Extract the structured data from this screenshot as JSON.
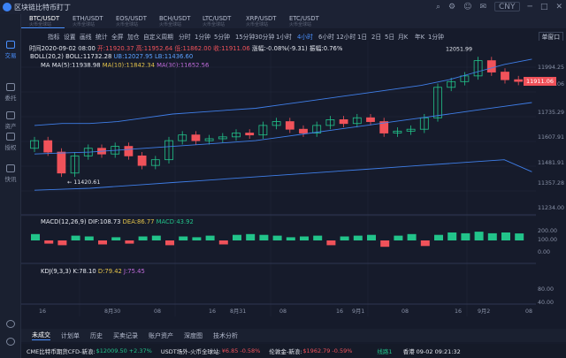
{
  "titlebar": {
    "title": "区块链比特币盯丁",
    "currency": "CNY"
  },
  "sidebar": {
    "items": [
      {
        "label": "交易"
      },
      {
        "label": "委托"
      },
      {
        "label": "资产"
      },
      {
        "label": "授权"
      },
      {
        "label": "快讯"
      }
    ]
  },
  "tabs": [
    {
      "label": "BTC/USDT",
      "sub": "火币全球站"
    },
    {
      "label": "ETH/USDT",
      "sub": "火币全球站"
    },
    {
      "label": "EOS/USDT",
      "sub": "火币全球站"
    },
    {
      "label": "BCH/USDT",
      "sub": "火币全球站"
    },
    {
      "label": "LTC/USDT",
      "sub": "火币全球站"
    },
    {
      "label": "XRP/USDT",
      "sub": "火币全球站"
    },
    {
      "label": "ETC/USDT",
      "sub": "火币全球站"
    }
  ],
  "toolbar": {
    "buttons": [
      "指标",
      "设置",
      "画线",
      "统计",
      "全屏",
      "加仓",
      "自定义周期",
      "分时",
      "1分钟",
      "5分钟",
      "15分钟",
      "30分钟",
      "1小时",
      "4小时",
      "6小时",
      "12小时",
      "1日",
      "2日",
      "5日",
      "月K",
      "年K",
      "1分钟"
    ],
    "active": "4小时",
    "layout": "单窗口"
  },
  "info": {
    "time": "时间2020-09-02 08:00",
    "open": "开:11920.37",
    "high": "高:11952.64",
    "low": "低:11862.00",
    "close": "收:11911.06",
    "change": "涨幅:-0.08%(-9.31)",
    "amp": "振幅:0.76%"
  },
  "legends": {
    "boll": {
      "name": "BOLL(20,2)",
      "boll": "BOLL:11732.28",
      "ub": "UB:12027.95",
      "lb": "LB:11436.60"
    },
    "ma": {
      "name": "MA",
      "ma5": "MA(5):11938.98",
      "ma10": "MA(10):11842.34",
      "ma30": "MA(30):11652.56"
    },
    "macd": {
      "name": "MACD(12,26,9)",
      "dif": "DIF:108.73",
      "dea": "DEA:86.77",
      "macd": "MACD:43.92"
    },
    "kdj": {
      "name": "KDJ(9,3,3)",
      "k": "K:78.10",
      "d": "D:79.42",
      "j": "J:75.45"
    }
  },
  "axis": {
    "price": [
      "11994.25",
      "11864.06",
      "11735.29",
      "11607.91",
      "11481.91",
      "11357.28",
      "11234.00"
    ],
    "macd": [
      "200.00",
      "100.00",
      "0.00"
    ],
    "kdj": [
      "80.00",
      "40.00"
    ],
    "current": "11911.06"
  },
  "annotations": {
    "high": "12051.99",
    "low": "11420.61"
  },
  "time_axis": [
    "16",
    "8月30",
    "08",
    "16",
    "8月31",
    "08",
    "16",
    "9月1",
    "08",
    "16",
    "9月2",
    "08"
  ],
  "bottom": {
    "tabs": [
      "未成交",
      "计划单",
      "历史",
      "买卖记录",
      "账户资产",
      "深度图",
      "技术分析"
    ],
    "active": "未成交"
  },
  "status": {
    "items": [
      {
        "label": "CME比特币期货CFD-新浪:",
        "value": "$12009.50",
        "change": "+2.37%",
        "dir": "up"
      },
      {
        "label": "USDT场外-火币全球站:",
        "value": "¥6.85",
        "change": "-0.58%",
        "dir": "down"
      },
      {
        "label": "伦敦金-新浪:",
        "value": "$1962.79",
        "change": "-0.59%",
        "dir": "down"
      }
    ],
    "network": "线路1",
    "clock": "香港 09-02 09:21:32"
  },
  "chart_data": {
    "type": "candlestick",
    "candles": [
      {
        "o": 11560,
        "c": 11600
      },
      {
        "o": 11600,
        "c": 11540
      },
      {
        "o": 11540,
        "c": 11430
      },
      {
        "o": 11430,
        "c": 11520
      },
      {
        "o": 11520,
        "c": 11560
      },
      {
        "o": 11560,
        "c": 11530
      },
      {
        "o": 11530,
        "c": 11570
      },
      {
        "o": 11570,
        "c": 11520
      },
      {
        "o": 11520,
        "c": 11470
      },
      {
        "o": 11470,
        "c": 11500
      },
      {
        "o": 11500,
        "c": 11600
      },
      {
        "o": 11600,
        "c": 11630
      },
      {
        "o": 11630,
        "c": 11600
      },
      {
        "o": 11600,
        "c": 11610
      },
      {
        "o": 11610,
        "c": 11620
      },
      {
        "o": 11620,
        "c": 11640
      },
      {
        "o": 11640,
        "c": 11630
      },
      {
        "o": 11630,
        "c": 11680
      },
      {
        "o": 11680,
        "c": 11700
      },
      {
        "o": 11700,
        "c": 11660
      },
      {
        "o": 11660,
        "c": 11640
      },
      {
        "o": 11640,
        "c": 11680
      },
      {
        "o": 11680,
        "c": 11710
      },
      {
        "o": 11710,
        "c": 11690
      },
      {
        "o": 11690,
        "c": 11720
      },
      {
        "o": 11720,
        "c": 11700
      },
      {
        "o": 11700,
        "c": 11640
      },
      {
        "o": 11640,
        "c": 11650
      },
      {
        "o": 11650,
        "c": 11660
      },
      {
        "o": 11660,
        "c": 11720
      },
      {
        "o": 11720,
        "c": 11880
      },
      {
        "o": 11880,
        "c": 11910
      },
      {
        "o": 11910,
        "c": 11940
      },
      {
        "o": 11940,
        "c": 12020
      },
      {
        "o": 12020,
        "c": 11960
      },
      {
        "o": 11960,
        "c": 11920
      },
      {
        "o": 11920,
        "c": 11911
      }
    ],
    "boll_ub": [
      11680,
      11690,
      11690,
      11700,
      11720,
      11740,
      11750,
      11760,
      11770,
      11790,
      11810,
      11830,
      11850,
      11870,
      11890,
      11920,
      11960,
      12000,
      12028
    ],
    "boll_mid": [
      11530,
      11535,
      11540,
      11550,
      11560,
      11570,
      11580,
      11590,
      11600,
      11620,
      11640,
      11660,
      11680,
      11700,
      11720,
      11740,
      11760,
      11780,
      11800
    ],
    "boll_lb": [
      11340,
      11345,
      11350,
      11360,
      11370,
      11380,
      11390,
      11400,
      11410,
      11420,
      11430,
      11440,
      11450,
      11460,
      11470,
      11480,
      11490,
      11500,
      11437
    ],
    "macd_hist": [
      40,
      -20,
      -30,
      30,
      25,
      -25,
      20,
      -20,
      25,
      30,
      -30,
      25,
      20,
      30,
      -25,
      35,
      40,
      35,
      30,
      20,
      25,
      30,
      -30,
      25,
      30,
      35,
      -40,
      30,
      40,
      -35,
      35,
      50,
      45,
      55,
      45,
      50,
      44
    ]
  }
}
